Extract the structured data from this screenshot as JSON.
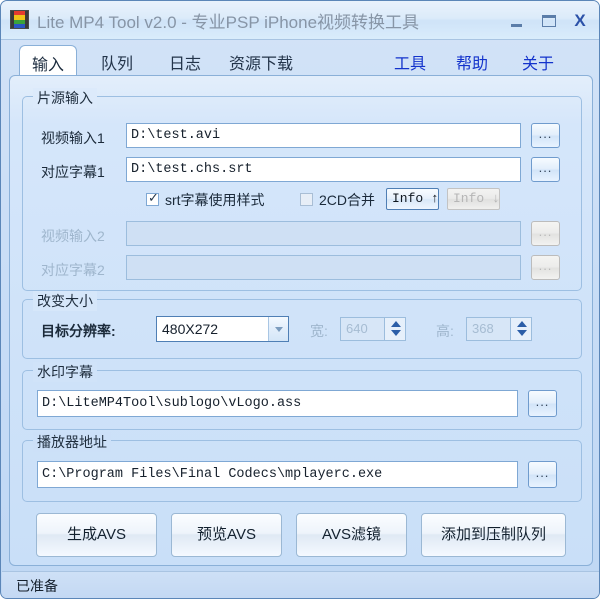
{
  "window": {
    "title": "Lite MP4 Tool v2.0 - 专业PSP iPhone视频转换工具",
    "icon": "film-strip-icon",
    "controls": {
      "minimize": "minimize-icon",
      "maximize": "maximize-icon",
      "close": "X"
    }
  },
  "tabs": [
    {
      "label": "输入",
      "active": true
    },
    {
      "label": "队列",
      "active": false
    },
    {
      "label": "日志",
      "active": false
    },
    {
      "label": "资源下载",
      "active": false
    }
  ],
  "menu": [
    {
      "label": "工具"
    },
    {
      "label": "帮助"
    },
    {
      "label": "关于"
    }
  ],
  "groups": {
    "source": {
      "legend": "片源输入",
      "video1_label": "视频输入1",
      "video1_value": "D:\\test.avi",
      "sub1_label": "对应字幕1",
      "sub1_value": "D:\\test.chs.srt",
      "srt_style_label": "srt字幕使用样式",
      "srt_style_checked": true,
      "twocd_label": "2CD合并",
      "twocd_checked": false,
      "info_up_label": "Info ↑",
      "info_down_label": "Info ↓",
      "video2_label": "视频输入2",
      "video2_value": "",
      "sub2_label": "对应字幕2",
      "sub2_value": "",
      "browse_label": "..."
    },
    "resize": {
      "legend": "改变大小",
      "resolution_label": "目标分辨率:",
      "resolution_value": "480X272",
      "width_label": "宽:",
      "width_value": "640",
      "height_label": "高:",
      "height_value": "368"
    },
    "watermark": {
      "legend": "水印字幕",
      "value": "D:\\LiteMP4Tool\\sublogo\\vLogo.ass",
      "browse_label": "..."
    },
    "player": {
      "legend": "播放器地址",
      "value": "C:\\Program Files\\Final Codecs\\mplayerc.exe",
      "browse_label": "..."
    }
  },
  "actions": [
    {
      "label": "生成AVS"
    },
    {
      "label": "预览AVS"
    },
    {
      "label": "AVS滤镜"
    },
    {
      "label": "添加到压制队列"
    }
  ],
  "statusbar": {
    "text": "已准备"
  },
  "colors": {
    "window_bg": "#c9dff8",
    "menu_link": "#1333cc",
    "accent_border": "#8ab0d8",
    "title_text": "#8795a6"
  }
}
